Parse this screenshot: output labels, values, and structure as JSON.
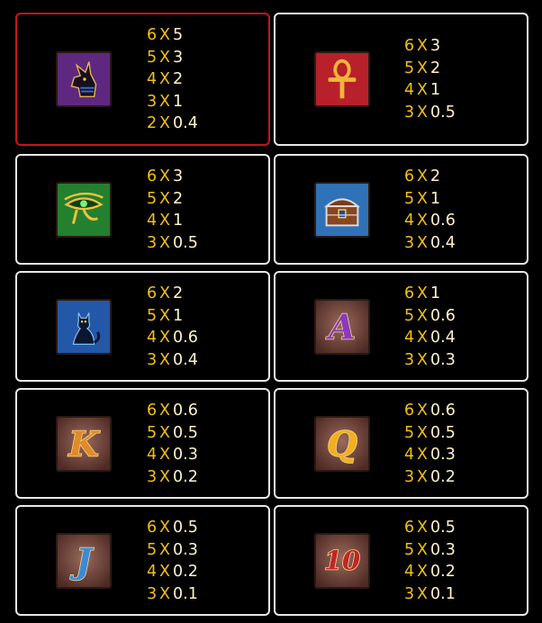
{
  "paytable": [
    {
      "symbol": "anubis-icon",
      "bg": "#6b2f86",
      "highlight": true,
      "pays": [
        [
          "6",
          "5"
        ],
        [
          "5",
          "3"
        ],
        [
          "4",
          "2"
        ],
        [
          "3",
          "1"
        ],
        [
          "2",
          "0.4"
        ]
      ]
    },
    {
      "symbol": "ankh-icon",
      "bg": "#b21f1f",
      "highlight": false,
      "pays": [
        [
          "6",
          "3"
        ],
        [
          "5",
          "2"
        ],
        [
          "4",
          "1"
        ],
        [
          "3",
          "0.5"
        ]
      ]
    },
    {
      "symbol": "eye-of-horus-icon",
      "bg": "#1f7a2a",
      "highlight": false,
      "pays": [
        [
          "6",
          "3"
        ],
        [
          "5",
          "2"
        ],
        [
          "4",
          "1"
        ],
        [
          "3",
          "0.5"
        ]
      ]
    },
    {
      "symbol": "treasure-chest-icon",
      "bg": "#2d6fb3",
      "highlight": false,
      "pays": [
        [
          "6",
          "2"
        ],
        [
          "5",
          "1"
        ],
        [
          "4",
          "0.6"
        ],
        [
          "3",
          "0.4"
        ]
      ]
    },
    {
      "symbol": "bastet-cat-icon",
      "bg": "#1f4f9e",
      "highlight": false,
      "pays": [
        [
          "6",
          "2"
        ],
        [
          "5",
          "1"
        ],
        [
          "4",
          "0.6"
        ],
        [
          "3",
          "0.4"
        ]
      ]
    },
    {
      "symbol": "letter-a-icon",
      "letter": "A",
      "letterColor": "#8a3ac0",
      "bg": "#7a4a40",
      "highlight": false,
      "pays": [
        [
          "6",
          "1"
        ],
        [
          "5",
          "0.6"
        ],
        [
          "4",
          "0.4"
        ],
        [
          "3",
          "0.3"
        ]
      ]
    },
    {
      "symbol": "letter-k-icon",
      "letter": "K",
      "letterColor": "#e08a2a",
      "bg": "#7a4a40",
      "highlight": false,
      "pays": [
        [
          "6",
          "0.6"
        ],
        [
          "5",
          "0.5"
        ],
        [
          "4",
          "0.3"
        ],
        [
          "3",
          "0.2"
        ]
      ]
    },
    {
      "symbol": "letter-q-icon",
      "letter": "Q",
      "letterColor": "#f0b020",
      "bg": "#7a4a40",
      "highlight": false,
      "pays": [
        [
          "6",
          "0.6"
        ],
        [
          "5",
          "0.5"
        ],
        [
          "4",
          "0.3"
        ],
        [
          "3",
          "0.2"
        ]
      ]
    },
    {
      "symbol": "letter-j-icon",
      "letter": "J",
      "letterColor": "#3a8ad8",
      "bg": "#7a4a40",
      "highlight": false,
      "pays": [
        [
          "6",
          "0.5"
        ],
        [
          "5",
          "0.3"
        ],
        [
          "4",
          "0.2"
        ],
        [
          "3",
          "0.1"
        ]
      ]
    },
    {
      "symbol": "number-10-icon",
      "letter": "10",
      "letterColor": "#c0262a",
      "bg": "#7a4a40",
      "highlight": false,
      "pays": [
        [
          "6",
          "0.5"
        ],
        [
          "5",
          "0.3"
        ],
        [
          "4",
          "0.2"
        ],
        [
          "3",
          "0.1"
        ]
      ]
    }
  ],
  "multiplier_sign": "X"
}
